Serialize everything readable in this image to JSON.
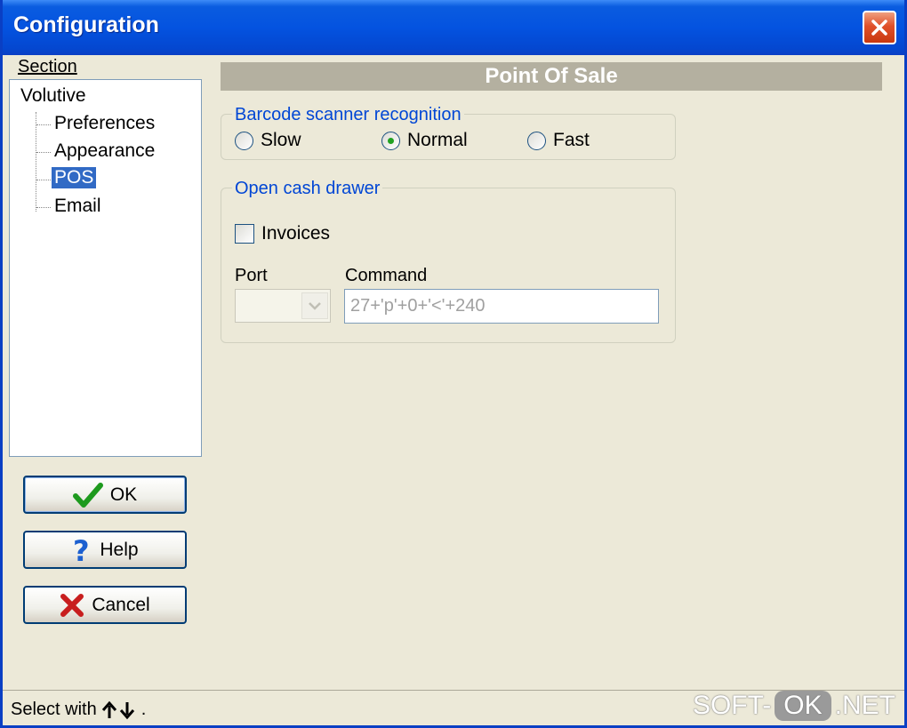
{
  "window": {
    "title": "Configuration"
  },
  "sidebar": {
    "section_label": "Section",
    "tree": {
      "root": "Volutive",
      "children": [
        "Preferences",
        "Appearance",
        "POS",
        "Email"
      ],
      "selected": "POS"
    }
  },
  "buttons": {
    "ok": "OK",
    "help": "Help",
    "cancel": "Cancel"
  },
  "panel": {
    "header": "Point Of Sale",
    "barcode": {
      "legend": "Barcode scanner recognition",
      "options": [
        "Slow",
        "Normal",
        "Fast"
      ],
      "selected": "Normal"
    },
    "cash_drawer": {
      "legend": "Open cash drawer",
      "invoices_label": "Invoices",
      "invoices_checked": false,
      "port_label": "Port",
      "port_value": "",
      "command_label": "Command",
      "command_value": "27+'p'+0+'<'+240"
    }
  },
  "status": {
    "text": "Select with"
  },
  "watermark": {
    "left": "SOFT-",
    "middle": "OK",
    "right": ".NET"
  },
  "colors": {
    "title_bar": "#0453e0",
    "selection": "#316ac5",
    "legend": "#0046d5",
    "close": "#e0502a"
  }
}
